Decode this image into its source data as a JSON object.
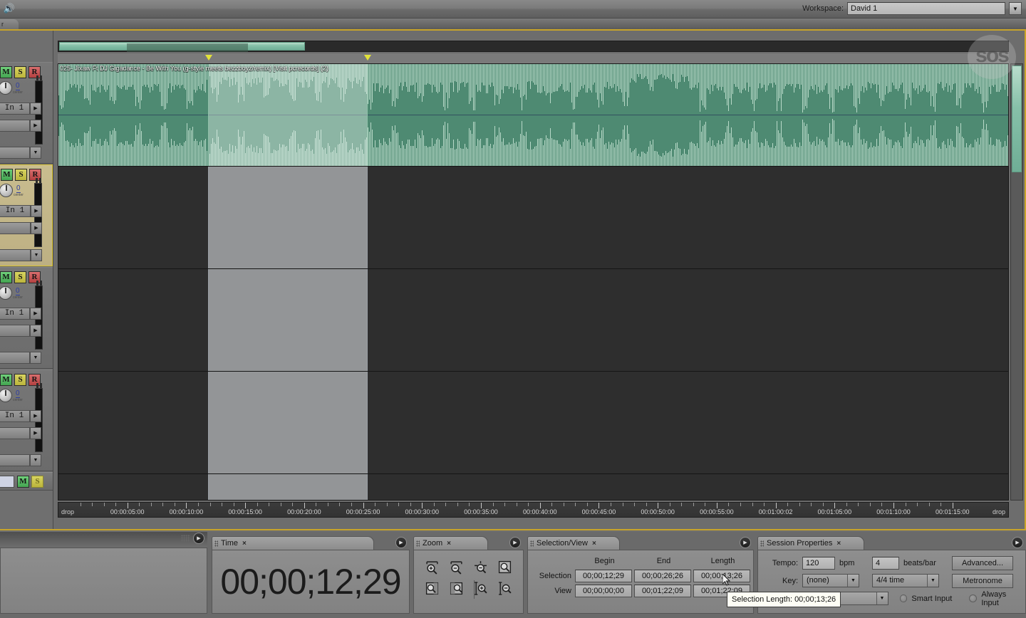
{
  "topbar": {
    "app_icon": "speaker-icon",
    "workspace_label": "Workspace:",
    "workspace_value": "David 1",
    "dropdown_glyph": "▼"
  },
  "strip2": {
    "tab_label": "r"
  },
  "watermark": {
    "text": "sos"
  },
  "tracks": [
    {
      "id": 1,
      "mute": "M",
      "solo": "S",
      "record": "R",
      "pan": "0",
      "pan_sub": "center",
      "input": "In 1",
      "selected": false
    },
    {
      "id": 2,
      "mute": "M",
      "solo": "S",
      "record": "R",
      "pan": "0",
      "pan_sub": "center",
      "input": "In 1",
      "selected": true
    },
    {
      "id": 3,
      "mute": "M",
      "solo": "S",
      "record": "R",
      "pan": "0",
      "pan_sub": "center",
      "input": "In 1",
      "selected": false
    },
    {
      "id": 4,
      "mute": "M",
      "solo": "S",
      "record": "R",
      "pan": "0",
      "pan_sub": "center",
      "input": "In 1",
      "selected": false
    }
  ],
  "master": {
    "mute": "M",
    "solo": "S"
  },
  "clip": {
    "title": "025- Jixaw Ft DJ Gigadance - Be With You (g-style meets bezzboyz/remix) [Visit pcrecords] (2)",
    "waveform_color": "#b8d9c8",
    "background_color": "#4e8a72"
  },
  "ruler": {
    "left_drop": "drop",
    "right_drop": "drop",
    "labels": [
      "00:00:05:00",
      "00:00:10:00",
      "00:00:15:00",
      "00:00:20:00",
      "00:00:25:00",
      "00:00:30:00",
      "00:00:35:00",
      "00:00:40:00",
      "00:00:45:00",
      "00:00:50:00",
      "00:00:55:00",
      "00:01:00:02",
      "00:01:05:00",
      "00:01:10:00",
      "00:01:15:00"
    ]
  },
  "panels": {
    "time": {
      "tab": "Time",
      "close": "×",
      "value": "00;00;12;29"
    },
    "zoom": {
      "tab": "Zoom",
      "close": "×",
      "buttons": [
        "zoom-in-horizontal-icon",
        "zoom-out-horizontal-icon",
        "zoom-out-full-horizontal-icon",
        "zoom-to-selection-icon",
        "zoom-in-to-selection-left-icon",
        "zoom-to-selection-right-icon",
        "zoom-in-vertical-icon",
        "zoom-out-vertical-icon"
      ]
    },
    "selection_view": {
      "tab": "Selection/View",
      "close": "×",
      "columns": [
        "Begin",
        "End",
        "Length"
      ],
      "rows": [
        {
          "label": "Selection",
          "begin": "00;00;12;29",
          "end": "00;00;26;26",
          "length": "00;00;13;26"
        },
        {
          "label": "View",
          "begin": "00;00;00;00",
          "end": "00;01;22;09",
          "length": "00;01;22;09"
        }
      ]
    },
    "session_properties": {
      "tab": "Session Properties",
      "close": "×",
      "tempo_label": "Tempo:",
      "tempo_value": "120",
      "bpm_label": "bpm",
      "beats_value": "4",
      "beats_label": "beats/bar",
      "advanced_button": "Advanced...",
      "key_label": "Key:",
      "key_value": "(none)",
      "time_sig_value": "4/4 time",
      "metronome_button": "Metronome",
      "smart_input_label": "Smart Input",
      "always_input_label": "Always Input",
      "dropdown_glyph": "▼"
    }
  },
  "tooltip": {
    "text": "Selection Length: 00;00;13;26"
  },
  "colors": {
    "focus_frame": "#c8a42a",
    "selection_marker": "#e2e23a",
    "mute_green": "#44a551",
    "solo_yellow": "#bcb53c",
    "record_red": "#b34040",
    "clip_green": "#4e8a72",
    "scrollbar_green": "#86c0a8"
  }
}
